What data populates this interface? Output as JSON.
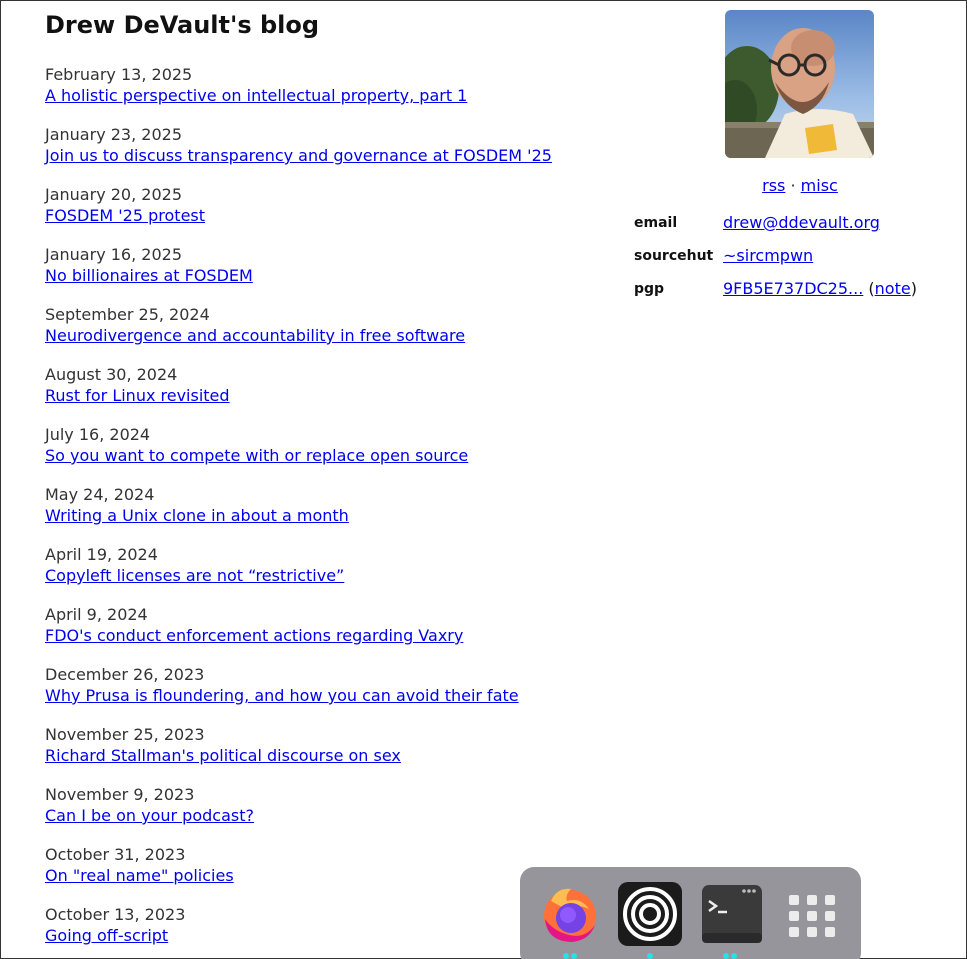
{
  "blog": {
    "title": "Drew DeVault's blog"
  },
  "posts": [
    {
      "date": "February 13, 2025",
      "title": "A holistic perspective on intellectual property, part 1"
    },
    {
      "date": "January 23, 2025",
      "title": "Join us to discuss transparency and governance at FOSDEM '25"
    },
    {
      "date": "January 20, 2025",
      "title": "FOSDEM '25 protest"
    },
    {
      "date": "January 16, 2025",
      "title": "No billionaires at FOSDEM"
    },
    {
      "date": "September 25, 2024",
      "title": "Neurodivergence and accountability in free software"
    },
    {
      "date": "August 30, 2024",
      "title": "Rust for Linux revisited"
    },
    {
      "date": "July 16, 2024",
      "title": "So you want to compete with or replace open source"
    },
    {
      "date": "May 24, 2024",
      "title": "Writing a Unix clone in about a month"
    },
    {
      "date": "April 19, 2024",
      "title": "Copyleft licenses are not “restrictive”"
    },
    {
      "date": "April 9, 2024",
      "title": "FDO's conduct enforcement actions regarding Vaxry"
    },
    {
      "date": "December 26, 2023",
      "title": "Why Prusa is floundering, and how you can avoid their fate"
    },
    {
      "date": "November 25, 2023",
      "title": "Richard Stallman's political discourse on sex"
    },
    {
      "date": "November 9, 2023",
      "title": "Can I be on your podcast?"
    },
    {
      "date": "October 31, 2023",
      "title": "On \"real name\" policies"
    },
    {
      "date": "October 13, 2023",
      "title": "Going off-script"
    }
  ],
  "sidebar": {
    "feed_links": {
      "rss": "rss",
      "separator": "·",
      "misc": "misc"
    },
    "contacts": {
      "email_label": "email",
      "email_value": "drew@ddevault.org",
      "sourcehut_label": "sourcehut",
      "sourcehut_value": "~sircmpwn",
      "pgp_label": "pgp",
      "pgp_value": "9FB5E737DC25...",
      "pgp_note_open": "(",
      "pgp_note": "note",
      "pgp_note_close": ")"
    }
  },
  "dock": {
    "items": [
      {
        "icon": "firefox-icon",
        "running": true
      },
      {
        "icon": "concentric-circles-app-icon",
        "running": true
      },
      {
        "icon": "terminal-icon",
        "running": true
      },
      {
        "icon": "app-grid-icon",
        "running": false
      }
    ],
    "accent_color": "#29e0e6",
    "background_color": "#96959c"
  }
}
